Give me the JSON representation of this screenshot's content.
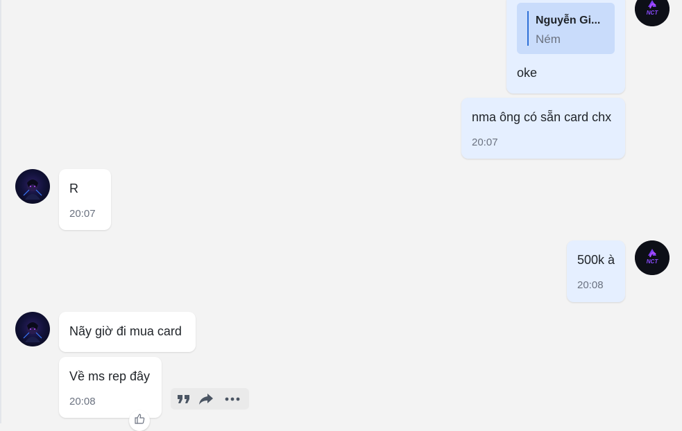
{
  "conversation": {
    "messages": [
      {
        "id": "m1",
        "sender": "self",
        "quote": {
          "name": "Nguyễn Gi...",
          "text": "Ném"
        },
        "text": "oke"
      },
      {
        "id": "m2",
        "sender": "self",
        "text": "nma ông có sẵn card chx",
        "time": "20:07"
      },
      {
        "id": "m3",
        "sender": "other",
        "text": "R",
        "time": "20:07"
      },
      {
        "id": "m4",
        "sender": "self",
        "text": "500k à",
        "time": "20:08"
      },
      {
        "id": "m5",
        "sender": "other",
        "text": "Nãy giờ đi mua card"
      },
      {
        "id": "m6",
        "sender": "other",
        "text": "Về ms rep đây",
        "time": "20:08"
      }
    ]
  },
  "avatars": {
    "self_logo_text": "NCT"
  },
  "message_actions": {
    "icons": [
      "quote-icon",
      "forward-icon",
      "more-icon"
    ],
    "reaction_icon": "thumbs-up-icon"
  },
  "colors": {
    "background": "#f3f3f3",
    "own_bubble": "#e5efff",
    "other_bubble": "#ffffff",
    "quote_box": "#c9dcfb",
    "quote_bar": "#2d6fd6",
    "timestamp": "#6b7280"
  }
}
